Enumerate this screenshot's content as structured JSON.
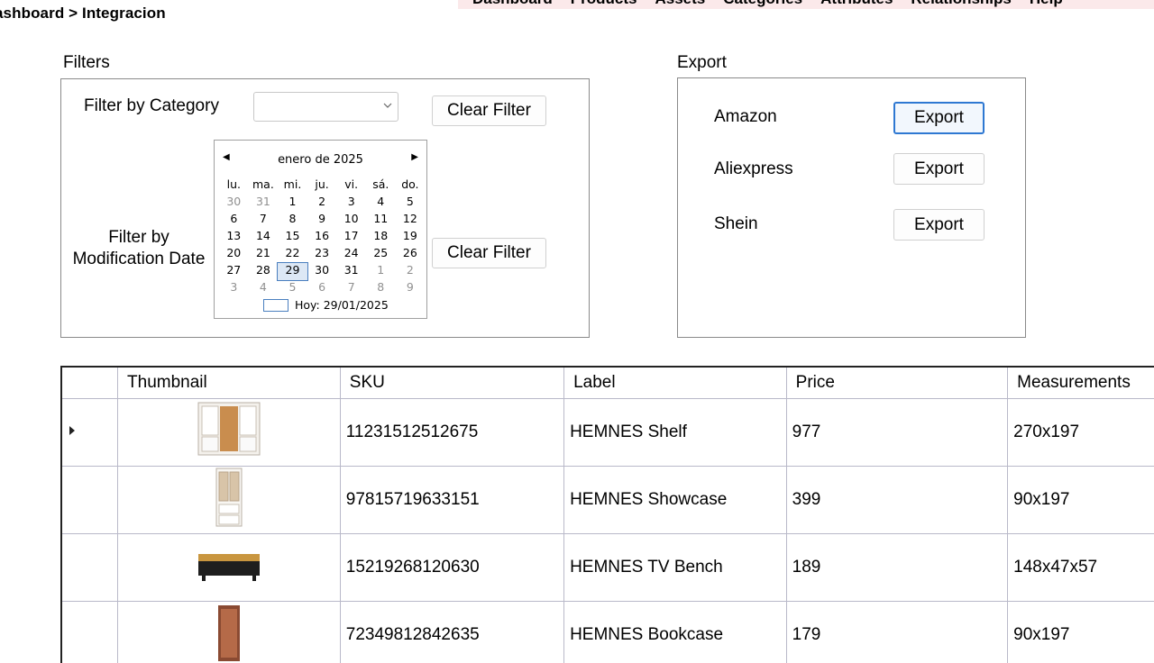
{
  "breadcrumb": "ashboard > Integracion",
  "nav": [
    "Dashboard",
    "Products",
    "Assets",
    "Categories",
    "Attributes",
    "Relationships",
    "Help"
  ],
  "filters": {
    "title": "Filters",
    "category_label": "Filter by Category",
    "category_value": "",
    "clear_filter": "Clear Filter",
    "date_label_line1": "Filter by",
    "date_label_line2": "Modification Date",
    "clear_filter_2": "Clear Filter"
  },
  "calendar": {
    "month": "enero de 2025",
    "weekdays": [
      "lu.",
      "ma.",
      "mi.",
      "ju.",
      "vi.",
      "sá.",
      "do."
    ],
    "weeks": [
      [
        "30",
        "31",
        "1",
        "2",
        "3",
        "4",
        "5"
      ],
      [
        "6",
        "7",
        "8",
        "9",
        "10",
        "11",
        "12"
      ],
      [
        "13",
        "14",
        "15",
        "16",
        "17",
        "18",
        "19"
      ],
      [
        "20",
        "21",
        "22",
        "23",
        "24",
        "25",
        "26"
      ],
      [
        "27",
        "28",
        "29",
        "30",
        "31",
        "1",
        "2"
      ],
      [
        "3",
        "4",
        "5",
        "6",
        "7",
        "8",
        "9"
      ]
    ],
    "selected_day": "29",
    "today": "Hoy: 29/01/2025"
  },
  "export": {
    "title": "Export",
    "rows": [
      {
        "name": "Amazon",
        "button": "Export"
      },
      {
        "name": "Aliexpress",
        "button": "Export"
      },
      {
        "name": "Shein",
        "button": "Export"
      }
    ]
  },
  "table": {
    "columns": [
      "Thumbnail",
      "SKU",
      "Label",
      "Price",
      "Measurements"
    ],
    "rows": [
      {
        "thumb": "hemnes-shelf-image",
        "sku": "11231512512675",
        "label": "HEMNES Shelf",
        "price": "977",
        "measurements": "270x197"
      },
      {
        "thumb": "hemnes-showcase-image",
        "sku": "97815719633151",
        "label": "HEMNES Showcase",
        "price": "399",
        "measurements": "90x197"
      },
      {
        "thumb": "hemnes-tv-bench-image",
        "sku": "15219268120630",
        "label": "HEMNES TV Bench",
        "price": "189",
        "measurements": "148x47x57"
      },
      {
        "thumb": "hemnes-bookcase-image",
        "sku": "72349812842635",
        "label": "HEMNES Bookcase",
        "price": "179",
        "measurements": "90x197"
      }
    ]
  }
}
